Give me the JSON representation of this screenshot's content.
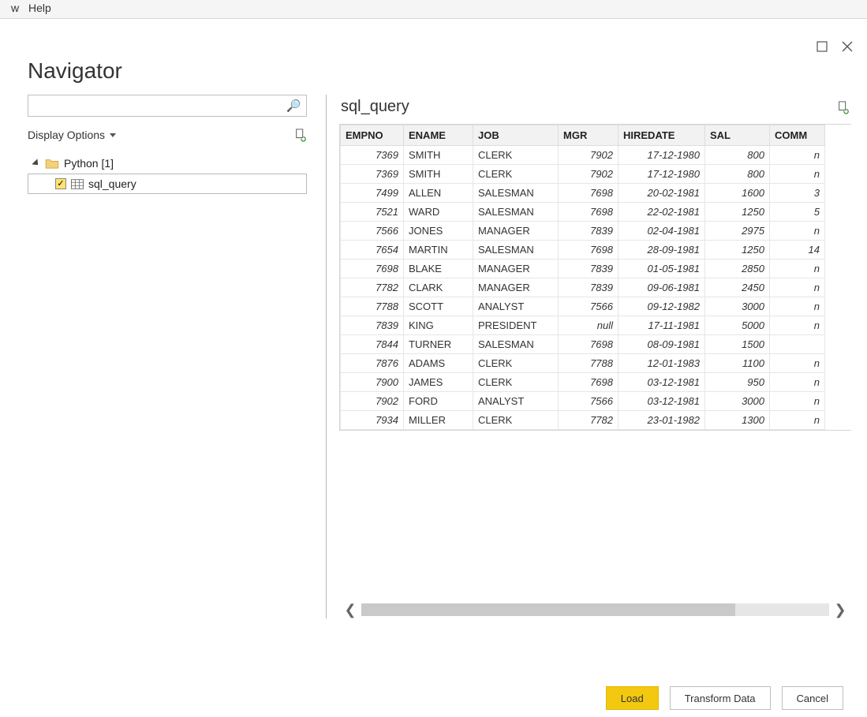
{
  "menubar": {
    "item0": "w",
    "item1": "Help"
  },
  "dialog": {
    "title": "Navigator",
    "search_placeholder": "",
    "display_options": "Display Options",
    "tree": {
      "db_label": "Python [1]",
      "item_label": "sql_query"
    },
    "preview_title": "sql_query"
  },
  "table": {
    "columns": [
      "EMPNO",
      "ENAME",
      "JOB",
      "MGR",
      "HIREDATE",
      "SAL",
      "COMM"
    ],
    "rows": [
      {
        "EMPNO": "7369",
        "ENAME": "SMITH",
        "JOB": "CLERK",
        "MGR": "7902",
        "HIREDATE": "17-12-1980",
        "SAL": "800",
        "COMM": "n"
      },
      {
        "EMPNO": "7369",
        "ENAME": "SMITH",
        "JOB": "CLERK",
        "MGR": "7902",
        "HIREDATE": "17-12-1980",
        "SAL": "800",
        "COMM": "n"
      },
      {
        "EMPNO": "7499",
        "ENAME": "ALLEN",
        "JOB": "SALESMAN",
        "MGR": "7698",
        "HIREDATE": "20-02-1981",
        "SAL": "1600",
        "COMM": "3"
      },
      {
        "EMPNO": "7521",
        "ENAME": "WARD",
        "JOB": "SALESMAN",
        "MGR": "7698",
        "HIREDATE": "22-02-1981",
        "SAL": "1250",
        "COMM": "5"
      },
      {
        "EMPNO": "7566",
        "ENAME": "JONES",
        "JOB": "MANAGER",
        "MGR": "7839",
        "HIREDATE": "02-04-1981",
        "SAL": "2975",
        "COMM": "n"
      },
      {
        "EMPNO": "7654",
        "ENAME": "MARTIN",
        "JOB": "SALESMAN",
        "MGR": "7698",
        "HIREDATE": "28-09-1981",
        "SAL": "1250",
        "COMM": "14"
      },
      {
        "EMPNO": "7698",
        "ENAME": "BLAKE",
        "JOB": "MANAGER",
        "MGR": "7839",
        "HIREDATE": "01-05-1981",
        "SAL": "2850",
        "COMM": "n"
      },
      {
        "EMPNO": "7782",
        "ENAME": "CLARK",
        "JOB": "MANAGER",
        "MGR": "7839",
        "HIREDATE": "09-06-1981",
        "SAL": "2450",
        "COMM": "n"
      },
      {
        "EMPNO": "7788",
        "ENAME": "SCOTT",
        "JOB": "ANALYST",
        "MGR": "7566",
        "HIREDATE": "09-12-1982",
        "SAL": "3000",
        "COMM": "n"
      },
      {
        "EMPNO": "7839",
        "ENAME": "KING",
        "JOB": "PRESIDENT",
        "MGR": "null",
        "HIREDATE": "17-11-1981",
        "SAL": "5000",
        "COMM": "n"
      },
      {
        "EMPNO": "7844",
        "ENAME": "TURNER",
        "JOB": "SALESMAN",
        "MGR": "7698",
        "HIREDATE": "08-09-1981",
        "SAL": "1500",
        "COMM": ""
      },
      {
        "EMPNO": "7876",
        "ENAME": "ADAMS",
        "JOB": "CLERK",
        "MGR": "7788",
        "HIREDATE": "12-01-1983",
        "SAL": "1100",
        "COMM": "n"
      },
      {
        "EMPNO": "7900",
        "ENAME": "JAMES",
        "JOB": "CLERK",
        "MGR": "7698",
        "HIREDATE": "03-12-1981",
        "SAL": "950",
        "COMM": "n"
      },
      {
        "EMPNO": "7902",
        "ENAME": "FORD",
        "JOB": "ANALYST",
        "MGR": "7566",
        "HIREDATE": "03-12-1981",
        "SAL": "3000",
        "COMM": "n"
      },
      {
        "EMPNO": "7934",
        "ENAME": "MILLER",
        "JOB": "CLERK",
        "MGR": "7782",
        "HIREDATE": "23-01-1982",
        "SAL": "1300",
        "COMM": "n"
      }
    ]
  },
  "footer": {
    "load": "Load",
    "transform": "Transform Data",
    "cancel": "Cancel"
  }
}
